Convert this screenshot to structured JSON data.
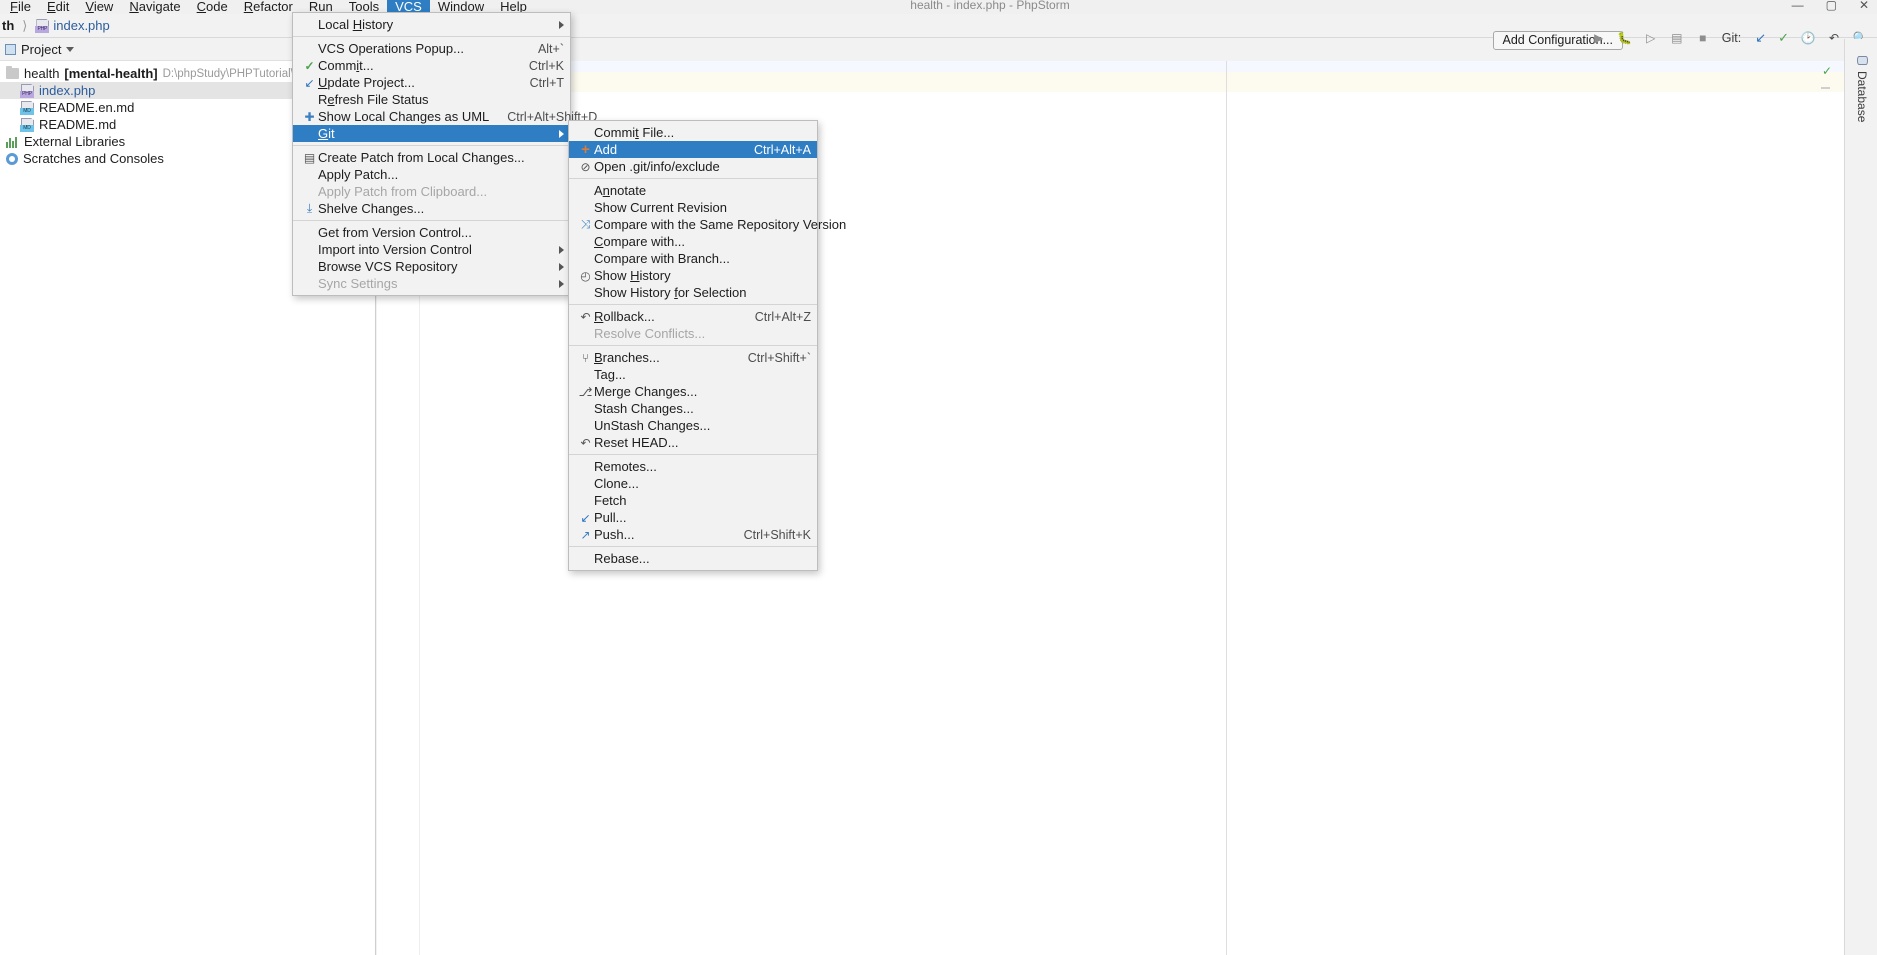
{
  "window": {
    "title": "health - index.php - PhpStorm",
    "buttons": [
      "—",
      "▢",
      "✕"
    ]
  },
  "menubar": {
    "items": [
      {
        "label": "File",
        "mnemonic": "F"
      },
      {
        "label": "Edit",
        "mnemonic": "E"
      },
      {
        "label": "View",
        "mnemonic": "V"
      },
      {
        "label": "Navigate",
        "mnemonic": "N"
      },
      {
        "label": "Code",
        "mnemonic": "C"
      },
      {
        "label": "Refactor",
        "mnemonic": "R"
      },
      {
        "label": "Run",
        "mnemonic": "R"
      },
      {
        "label": "Tools",
        "mnemonic": "T"
      },
      {
        "label": "VCS",
        "mnemonic": "S",
        "active": true
      },
      {
        "label": "Window",
        "mnemonic": "W"
      },
      {
        "label": "Help",
        "mnemonic": "H"
      }
    ]
  },
  "navbar": {
    "breadcrumb_root": "th",
    "breadcrumb_file": "index.php",
    "add_configuration_label": "Add Configuration...",
    "git_label": "Git:"
  },
  "toolwindow": {
    "title": "Project"
  },
  "project_tree": [
    {
      "label": "health",
      "bracket": "[mental-health]",
      "path": "D:\\phpStudy\\PHPTutorial\\WWW",
      "icon": "folder-icon",
      "level": 0,
      "selected": false
    },
    {
      "label": "index.php",
      "icon": "php-file-icon",
      "level": 1,
      "selected": true
    },
    {
      "label": "README.en.md",
      "icon": "markdown-file-icon",
      "level": 1,
      "selected": false
    },
    {
      "label": "README.md",
      "icon": "markdown-file-icon",
      "level": 1,
      "selected": false
    },
    {
      "label": "External Libraries",
      "icon": "library-icon",
      "level": 0,
      "selected": false
    },
    {
      "label": "Scratches and Consoles",
      "icon": "scratches-icon",
      "level": 0,
      "selected": false
    }
  ],
  "right_strip": {
    "database_tab": "Database"
  },
  "vcs_menu": {
    "items": [
      {
        "label": "Local History",
        "mnemonic": "H",
        "submenu": true,
        "icon": "",
        "shortcut": ""
      },
      {
        "sep": true
      },
      {
        "label": "VCS Operations Popup...",
        "shortcut": "Alt+`",
        "icon": ""
      },
      {
        "label": "Commit...",
        "mnemonic": "i",
        "shortcut": "Ctrl+K",
        "icon": "check-icon"
      },
      {
        "label": "Update Project...",
        "mnemonic": "U",
        "shortcut": "Ctrl+T",
        "icon": "update-arrow-icon"
      },
      {
        "label": "Refresh File Status",
        "mnemonic": "e",
        "shortcut": "",
        "icon": ""
      },
      {
        "label": "Show Local Changes as UML",
        "shortcut": "Ctrl+Alt+Shift+D",
        "icon": "uml-icon"
      },
      {
        "label": "Git",
        "mnemonic": "G",
        "submenu": true,
        "selected": true,
        "icon": ""
      },
      {
        "sep": true
      },
      {
        "label": "Create Patch from Local Changes...",
        "shortcut": "",
        "icon": "patch-icon"
      },
      {
        "label": "Apply Patch...",
        "shortcut": "",
        "icon": ""
      },
      {
        "label": "Apply Patch from Clipboard...",
        "shortcut": "",
        "icon": "",
        "disabled": true
      },
      {
        "label": "Shelve Changes...",
        "shortcut": "",
        "icon": "shelve-icon"
      },
      {
        "sep": true
      },
      {
        "label": "Get from Version Control...",
        "shortcut": "",
        "icon": ""
      },
      {
        "label": "Import into Version Control",
        "submenu": true,
        "icon": ""
      },
      {
        "label": "Browse VCS Repository",
        "submenu": true,
        "icon": ""
      },
      {
        "label": "Sync Settings",
        "submenu": true,
        "icon": "",
        "disabled": true
      }
    ]
  },
  "git_menu": {
    "items": [
      {
        "label": "Commit File...",
        "mnemonic": "t",
        "shortcut": "",
        "icon": ""
      },
      {
        "label": "Add",
        "shortcut": "Ctrl+Alt+A",
        "icon": "add-plus-icon",
        "selected": true
      },
      {
        "label": "Open .git/info/exclude",
        "shortcut": "",
        "icon": "exclude-file-icon"
      },
      {
        "sep": true
      },
      {
        "label": "Annotate",
        "mnemonic": "n",
        "shortcut": "",
        "icon": ""
      },
      {
        "label": "Show Current Revision",
        "shortcut": "",
        "icon": ""
      },
      {
        "label": "Compare with the Same Repository Version",
        "shortcut": "",
        "icon": "compare-icon"
      },
      {
        "label": "Compare with...",
        "mnemonic": "C",
        "shortcut": "",
        "icon": ""
      },
      {
        "label": "Compare with Branch...",
        "shortcut": "",
        "icon": ""
      },
      {
        "label": "Show History",
        "mnemonic": "H",
        "shortcut": "",
        "icon": "clock-icon"
      },
      {
        "label": "Show History for Selection",
        "mnemonic": "f",
        "shortcut": "",
        "icon": ""
      },
      {
        "sep": true
      },
      {
        "label": "Rollback...",
        "mnemonic": "R",
        "shortcut": "Ctrl+Alt+Z",
        "icon": "rollback-icon"
      },
      {
        "label": "Resolve Conflicts...",
        "shortcut": "",
        "icon": "",
        "disabled": true
      },
      {
        "sep": true
      },
      {
        "label": "Branches...",
        "mnemonic": "B",
        "shortcut": "Ctrl+Shift+`",
        "icon": "branch-icon"
      },
      {
        "label": "Tag...",
        "shortcut": "",
        "icon": ""
      },
      {
        "label": "Merge Changes...",
        "shortcut": "",
        "icon": "merge-icon"
      },
      {
        "label": "Stash Changes...",
        "shortcut": "",
        "icon": ""
      },
      {
        "label": "UnStash Changes...",
        "shortcut": "",
        "icon": ""
      },
      {
        "label": "Reset HEAD...",
        "shortcut": "",
        "icon": "reset-icon"
      },
      {
        "sep": true
      },
      {
        "label": "Remotes...",
        "shortcut": "",
        "icon": ""
      },
      {
        "label": "Clone...",
        "shortcut": "",
        "icon": ""
      },
      {
        "label": "Fetch",
        "shortcut": "",
        "icon": ""
      },
      {
        "label": "Pull...",
        "shortcut": "",
        "icon": "pull-icon"
      },
      {
        "label": "Push...",
        "shortcut": "",
        "icon": "push-icon",
        "shortcut2": "Ctrl+Shift+K"
      },
      {
        "sep": true
      },
      {
        "label": "Rebase...",
        "shortcut": "",
        "icon": ""
      }
    ]
  },
  "colors": {
    "accent": "#2f7ec4",
    "menu_bg": "#f2f2f2",
    "editor_bg": "#ffffff",
    "link": "#2b5c9e"
  }
}
